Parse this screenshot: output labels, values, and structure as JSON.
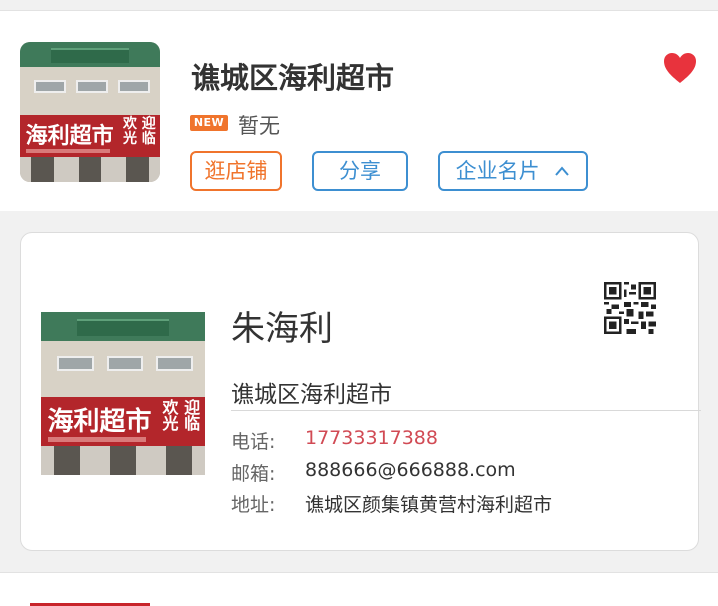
{
  "store": {
    "name": "谯城区海利超市",
    "new_badge": "NEW",
    "new_text": "暂无",
    "thumb_sign_top": "海利超市",
    "thumb_banner_main": "海利超市",
    "thumb_banner_side": "欢迎\n光临",
    "favorited": true
  },
  "actions": {
    "visit_label": "逛店铺",
    "share_label": "分享",
    "card_label": "企业名片",
    "card_chevron": "^"
  },
  "business_card": {
    "person_name": "朱海利",
    "company": "谯城区海利超市",
    "rows": [
      {
        "label": "电话:",
        "value": "17733317388"
      },
      {
        "label": "邮箱:",
        "value": "888666@666888.com"
      },
      {
        "label": "地址:",
        "value": "谯城区颜集镇黄营村海利超市"
      }
    ]
  },
  "colors": {
    "accent_blue": "#3d8fd1",
    "accent_orange": "#f0742c",
    "phone_red": "#d14a54",
    "heart_red": "#e8333d"
  },
  "icons": {
    "heart": "heart-icon",
    "qr": "qr-code-icon",
    "chevron": "chevron-up-icon"
  }
}
